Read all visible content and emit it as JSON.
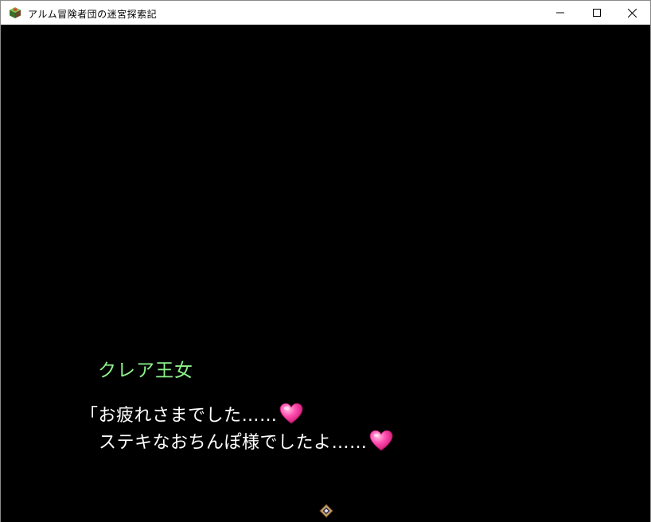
{
  "window": {
    "title": "アルム冒険者団の迷宮探索記",
    "icon": "game-cube-icon",
    "controls": [
      "minimize-icon",
      "maximize-icon",
      "close-icon"
    ]
  },
  "dialogue": {
    "speaker": "クレア王女",
    "speaker_color": "#8cf08c",
    "lines": [
      {
        "text": "「お疲れさまでした……",
        "icon": "heart-icon"
      },
      {
        "text": "ステキなおちんぽ様でしたよ……",
        "icon": "heart-icon"
      }
    ],
    "continue_indicator": "continue-cursor-icon"
  },
  "colors": {
    "background": "#000000",
    "text": "#ffffff",
    "heart": "#ff3fa6"
  }
}
